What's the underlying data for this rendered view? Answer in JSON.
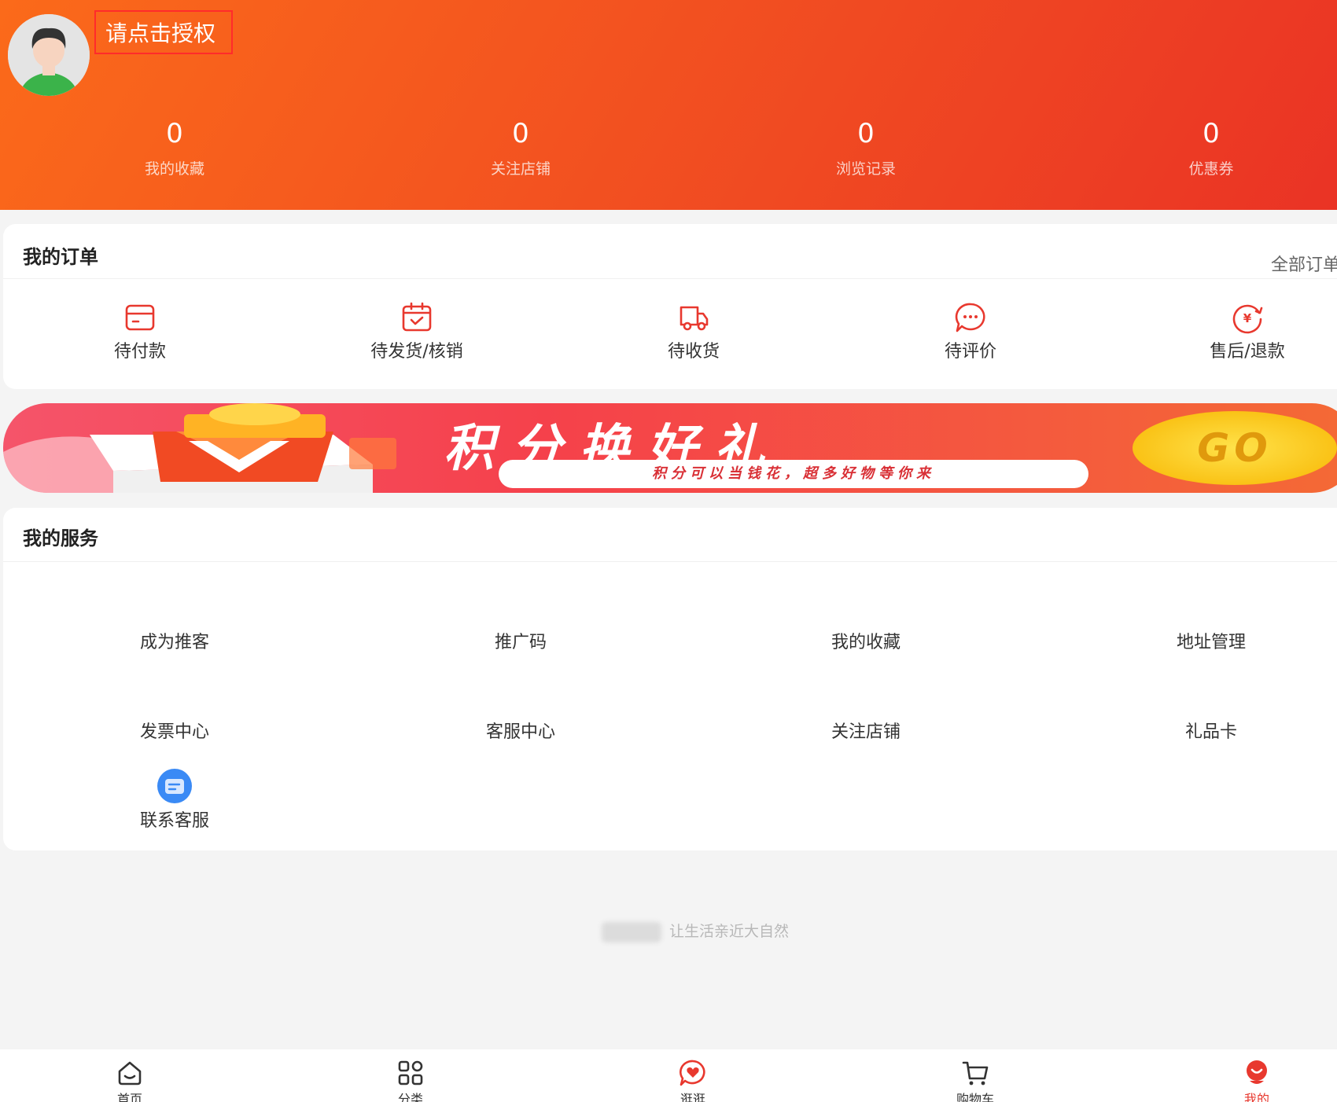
{
  "colors": {
    "accent": "#f04a22",
    "brand_red": "#e8382e",
    "service_icon_blue": "#3a8af5"
  },
  "profile": {
    "auth_label": "请点击授权",
    "stats": [
      {
        "value": "0",
        "label": "我的收藏"
      },
      {
        "value": "0",
        "label": "关注店铺"
      },
      {
        "value": "0",
        "label": "浏览记录"
      },
      {
        "value": "0",
        "label": "优惠券"
      }
    ]
  },
  "orders": {
    "title": "我的订单",
    "all_orders": "全部订单",
    "items": [
      {
        "label": "待付款",
        "icon": "wallet-card-icon"
      },
      {
        "label": "待发货/核销",
        "icon": "calendar-check-icon"
      },
      {
        "label": "待收货",
        "icon": "delivery-truck-icon"
      },
      {
        "label": "待评价",
        "icon": "chat-bubble-icon"
      },
      {
        "label": "售后/退款",
        "icon": "yuan-refund-icon"
      }
    ]
  },
  "banner": {
    "title": "积分换好礼",
    "subtitle": "积分可以当钱花，超多好物等你来",
    "go": "GO"
  },
  "services": {
    "title": "我的服务",
    "items": [
      "成为推客",
      "推广码",
      "我的收藏",
      "地址管理",
      "发票中心",
      "客服中心",
      "关注店铺",
      "礼品卡",
      "联系客服"
    ]
  },
  "footer": {
    "slogan": "让生活亲近大自然"
  },
  "tabbar": {
    "items": [
      {
        "label": "首页",
        "icon": "home-icon"
      },
      {
        "label": "分类",
        "icon": "grid-icon"
      },
      {
        "label": "逛逛",
        "icon": "heart-chat-icon"
      },
      {
        "label": "购物车",
        "icon": "cart-icon"
      },
      {
        "label": "我的",
        "icon": "profile-icon",
        "active": true
      }
    ]
  }
}
